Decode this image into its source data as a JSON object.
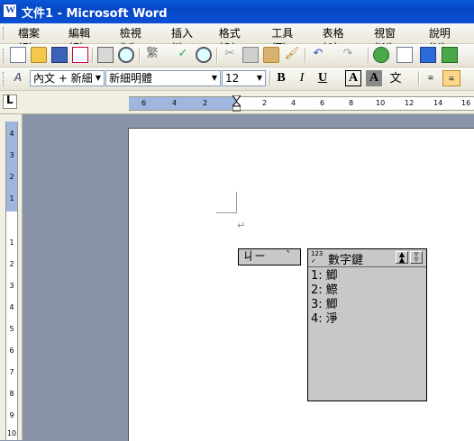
{
  "window": {
    "title": "文件1 - Microsoft Word"
  },
  "menu": {
    "items": [
      "檔案(F)",
      "編輯(E)",
      "檢視(V)",
      "插入(I)",
      "格式(O)",
      "工具(T)",
      "表格(A)",
      "視窗(W)",
      "說明(H)"
    ]
  },
  "toolbar_standard": {
    "icons": [
      "new-document-icon",
      "open-icon",
      "save-icon",
      "permission-icon",
      "print-icon",
      "print-preview-icon",
      "traditional-simplified-icon",
      "spelling-icon",
      "research-icon",
      "cut-icon",
      "copy-icon",
      "paste-icon",
      "format-painter-icon",
      "undo-icon",
      "redo-icon",
      "hyperlink-icon",
      "tables-borders-icon",
      "insert-table-icon",
      "insert-excel-icon"
    ],
    "convert_label": "繁"
  },
  "toolbar_format": {
    "style": "內文 + 新細明",
    "font": "新細明體",
    "size": "12",
    "bold": "B",
    "italic": "I",
    "underline": "U",
    "font_color": "A",
    "char_shading": "A",
    "phonetic": "文",
    "colors": {
      "active_button": "#fcd78a"
    }
  },
  "ruler": {
    "h_ticks": [
      "6",
      "4",
      "2",
      "2",
      "4",
      "6",
      "8",
      "10",
      "12",
      "14",
      "16"
    ],
    "v_ticks": [
      "4",
      "3",
      "2",
      "1",
      "1",
      "2",
      "3",
      "4",
      "5",
      "6",
      "7",
      "8",
      "9",
      "10"
    ]
  },
  "document": {
    "para_mark": "↵"
  },
  "ime": {
    "composition": {
      "zhuyin": "ㄐㄧ",
      "tone": "ˋ"
    },
    "candidate": {
      "header_icon": "123",
      "header": "數字鍵",
      "items": [
        "1: 鯽",
        "2: 鰶",
        "3: 鯽",
        "4: 淨"
      ]
    }
  }
}
